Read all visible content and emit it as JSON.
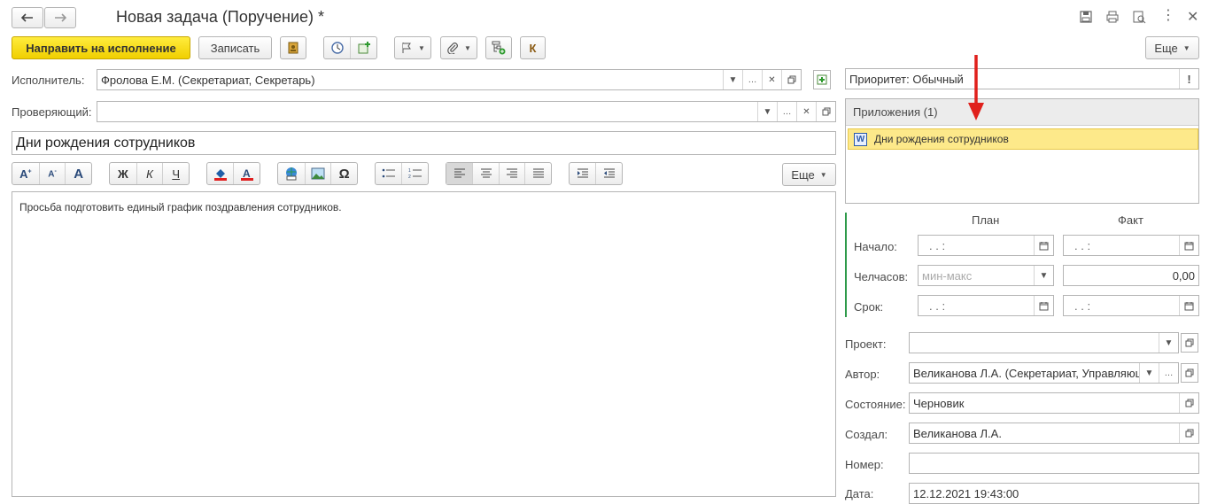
{
  "window": {
    "title": "Новая задача (Поручение) *"
  },
  "toolbar": {
    "submit_label": "Направить на исполнение",
    "save_label": "Записать",
    "more_label": "Еще",
    "k_label": "К"
  },
  "form": {
    "executor_label": "Исполнитель:",
    "executor_value": "Фролова Е.М. (Секретариат, Секретарь)",
    "reviewer_label": "Проверяющий:",
    "reviewer_value": "",
    "subject_value": "Дни рождения сотрудников",
    "body_text": "Просьба подготовить единый график поздравления сотрудников.",
    "editor_more_label": "Еще"
  },
  "editor_toolbar": {
    "bold": "Ж",
    "italic": "К",
    "underline": "Ч",
    "omega": "Ω"
  },
  "right": {
    "priority_value": "Приоритет: Обычный",
    "priority_marker": "!",
    "attachments_title": "Приложения (1)",
    "attachments": [
      {
        "name": "Дни рождения сотрудников",
        "badge": "W"
      }
    ],
    "schedule": {
      "plan_header": "План",
      "fact_header": "Факт",
      "start_label": "Начало:",
      "hours_label": "Челчасов:",
      "due_label": "Срок:",
      "date_mask": ".   .      :",
      "hours_placeholder": "мин-макс",
      "hours_fact": "0,00"
    },
    "project_label": "Проект:",
    "project_value": "",
    "author_label": "Автор:",
    "author_value": "Великанова Л.А. (Секретариат, Управляющ",
    "state_label": "Состояние:",
    "state_value": "Черновик",
    "created_label": "Создал:",
    "created_value": "Великанова Л.А.",
    "number_label": "Номер:",
    "number_value": "",
    "date_label": "Дата:",
    "date_value": "12.12.2021 19:43:00"
  },
  "colors": {
    "primary_button": "#f5d90a",
    "attachment_highlight": "#fde98a",
    "arrow": "#e0201c",
    "schedule_bar": "#2e9a4a"
  }
}
